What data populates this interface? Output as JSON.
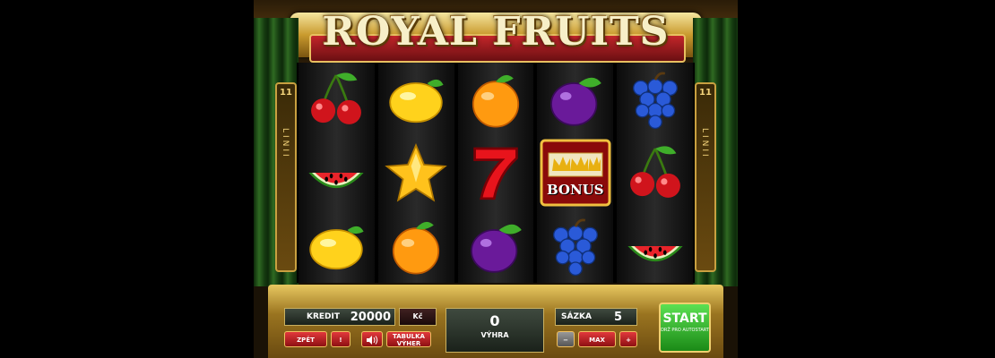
{
  "game": {
    "title": "ROYAL FRUITS",
    "lines_count": "11",
    "lines_word": "LINII"
  },
  "reels": [
    [
      "cherry",
      "watermelon",
      "lemon"
    ],
    [
      "lemon",
      "star",
      "orange"
    ],
    [
      "orange",
      "seven",
      "plum"
    ],
    [
      "plum",
      "bonus",
      "grapes"
    ],
    [
      "grapes",
      "cherry",
      "watermelon"
    ]
  ],
  "bonus_label": "BONUS",
  "panel": {
    "credit_label": "KREDIT",
    "credit_value": "20000",
    "currency": "Kč",
    "win_value": "0",
    "win_label": "VÝHRA",
    "bet_label": "SÁZKA",
    "bet_value": "5",
    "back_label": "ZPĚT",
    "info_label": "!",
    "sound_icon": "speaker-icon",
    "paytable_label": "TABULKA VÝHER",
    "minus_label": "−",
    "max_label": "MAX",
    "plus_label": "+",
    "start_label": "START",
    "start_hint": "DRŽ PRO AUTOSTART"
  },
  "colors": {
    "accent_gold": "#c9a040",
    "button_red": "#c3262a",
    "start_green": "#2fb52a"
  }
}
